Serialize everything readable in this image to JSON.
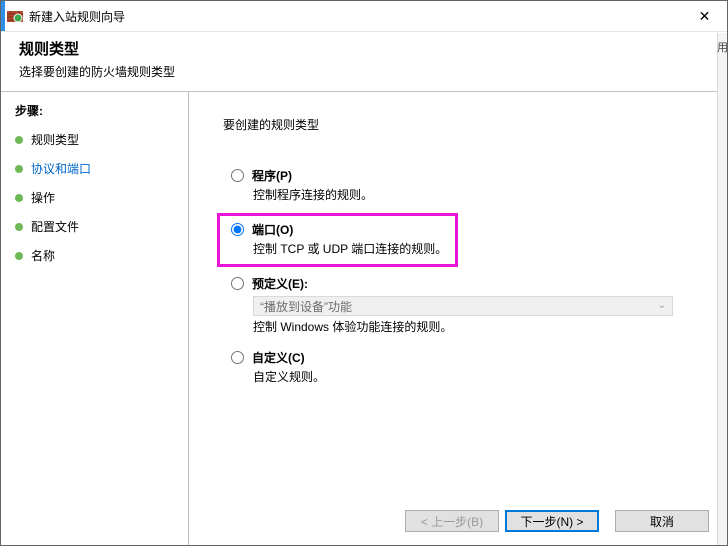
{
  "window": {
    "title": "新建入站规则向导",
    "close": "✕"
  },
  "header": {
    "title": "规则类型",
    "subtitle": "选择要创建的防火墙规则类型"
  },
  "sidebar": {
    "steps_label": "步骤:",
    "items": [
      {
        "label": "规则类型"
      },
      {
        "label": "协议和端口"
      },
      {
        "label": "操作"
      },
      {
        "label": "配置文件"
      },
      {
        "label": "名称"
      }
    ],
    "active_index": 1
  },
  "content": {
    "instruction": "要创建的规则类型",
    "options": [
      {
        "key": "program",
        "title": "程序(P)",
        "desc": "控制程序连接的规则。",
        "selected": false
      },
      {
        "key": "port",
        "title": "端口(O)",
        "desc": "控制 TCP 或 UDP 端口连接的规则。",
        "selected": true
      },
      {
        "key": "predef",
        "title": "预定义(E):",
        "desc": "控制 Windows 体验功能连接的规则。",
        "selected": false,
        "select_value": "“播放到设备”功能"
      },
      {
        "key": "custom",
        "title": "自定义(C)",
        "desc": "自定义规则。",
        "selected": false
      }
    ]
  },
  "footer": {
    "back": "< 上一步(B)",
    "next": "下一步(N) >",
    "cancel": "取消"
  },
  "peek": {
    "right_char": "用"
  },
  "colors": {
    "highlight": "#e815d4",
    "link": "#0066cc",
    "bullet": "#6fb858",
    "primary_border": "#0078d7"
  }
}
